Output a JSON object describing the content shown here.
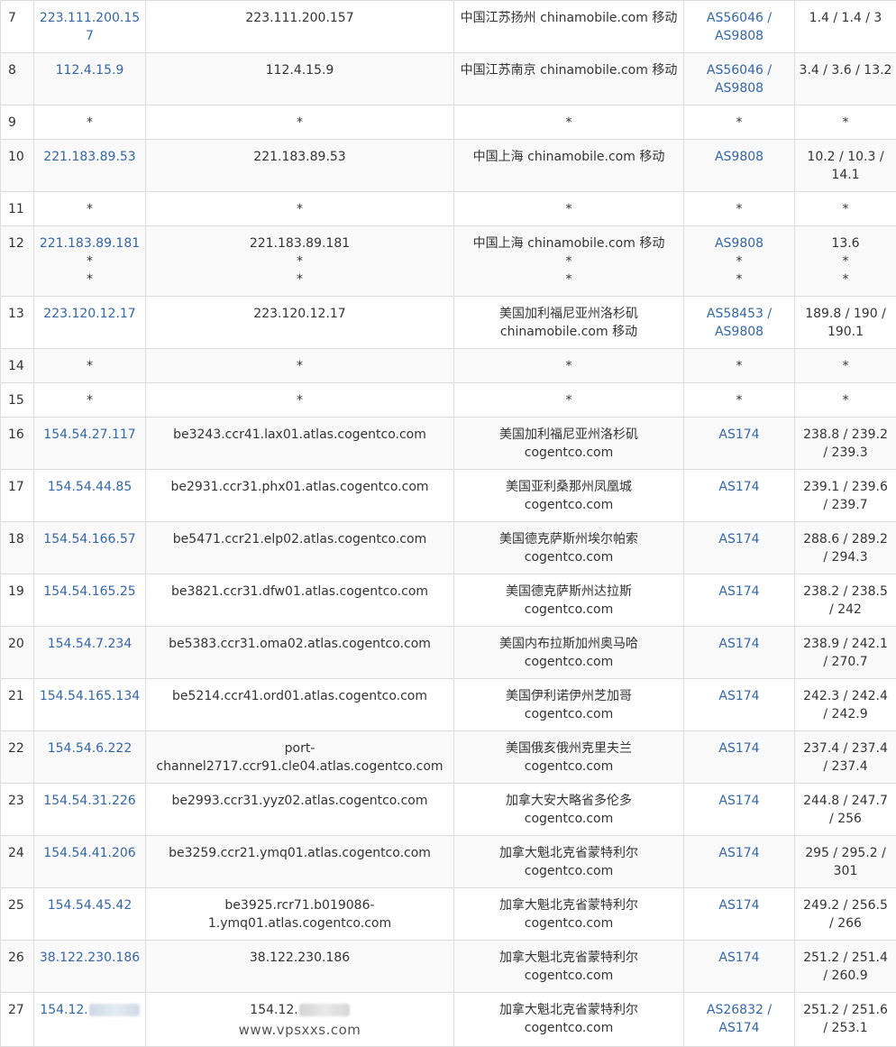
{
  "watermark": "www.vpsxxs.com",
  "rows": [
    {
      "hop": "7",
      "ip": [
        "223.111.200.157"
      ],
      "host": [
        "223.111.200.157"
      ],
      "loc": [
        "中国江苏扬州 chinamobile.com 移动"
      ],
      "asn": [
        "AS56046 /",
        "AS9808"
      ],
      "asn_link": [
        true,
        true
      ],
      "rtt": [
        "1.4 / 1.4 / 3"
      ]
    },
    {
      "hop": "8",
      "ip": [
        "112.4.15.9"
      ],
      "host": [
        "112.4.15.9"
      ],
      "loc": [
        "中国江苏南京 chinamobile.com 移动"
      ],
      "asn": [
        "AS56046 /",
        "AS9808"
      ],
      "asn_link": [
        true,
        true
      ],
      "rtt": [
        "3.4 / 3.6 / 13.2"
      ]
    },
    {
      "hop": "9",
      "ip": [
        "*"
      ],
      "host": [
        "*"
      ],
      "loc": [
        "*"
      ],
      "asn": [
        "*"
      ],
      "asn_link": [
        false
      ],
      "rtt": [
        "*"
      ]
    },
    {
      "hop": "10",
      "ip": [
        "221.183.89.53"
      ],
      "host": [
        "221.183.89.53"
      ],
      "loc": [
        "中国上海 chinamobile.com 移动"
      ],
      "asn": [
        "AS9808"
      ],
      "asn_link": [
        true
      ],
      "rtt": [
        "10.2 / 10.3 /",
        "14.1"
      ]
    },
    {
      "hop": "11",
      "ip": [
        "*"
      ],
      "host": [
        "*"
      ],
      "loc": [
        "*"
      ],
      "asn": [
        "*"
      ],
      "asn_link": [
        false
      ],
      "rtt": [
        "*"
      ]
    },
    {
      "hop": "12",
      "ip": [
        "221.183.89.181",
        "*",
        "*"
      ],
      "host": [
        "221.183.89.181",
        "*",
        "*"
      ],
      "loc": [
        "中国上海 chinamobile.com 移动",
        "*",
        "*"
      ],
      "asn": [
        "AS9808",
        "*",
        "*"
      ],
      "asn_link": [
        true,
        false,
        false
      ],
      "rtt": [
        "13.6",
        "*",
        "*"
      ]
    },
    {
      "hop": "13",
      "ip": [
        "223.120.12.17"
      ],
      "host": [
        "223.120.12.17"
      ],
      "loc": [
        "美国加利福尼亚州洛杉矶",
        "chinamobile.com 移动"
      ],
      "asn": [
        "AS58453 /",
        "AS9808"
      ],
      "asn_link": [
        true,
        true
      ],
      "rtt": [
        "189.8 / 190 /",
        "190.1"
      ]
    },
    {
      "hop": "14",
      "ip": [
        "*"
      ],
      "host": [
        "*"
      ],
      "loc": [
        "*"
      ],
      "asn": [
        "*"
      ],
      "asn_link": [
        false
      ],
      "rtt": [
        "*"
      ]
    },
    {
      "hop": "15",
      "ip": [
        "*"
      ],
      "host": [
        "*"
      ],
      "loc": [
        "*"
      ],
      "asn": [
        "*"
      ],
      "asn_link": [
        false
      ],
      "rtt": [
        "*"
      ]
    },
    {
      "hop": "16",
      "ip": [
        "154.54.27.117"
      ],
      "host": [
        "be3243.ccr41.lax01.atlas.cogentco.com"
      ],
      "loc": [
        "美国加利福尼亚州洛杉矶",
        "cogentco.com"
      ],
      "asn": [
        "AS174"
      ],
      "asn_link": [
        true
      ],
      "rtt": [
        "238.8 / 239.2",
        "/ 239.3"
      ]
    },
    {
      "hop": "17",
      "ip": [
        "154.54.44.85"
      ],
      "host": [
        "be2931.ccr31.phx01.atlas.cogentco.com"
      ],
      "loc": [
        "美国亚利桑那州凤凰城",
        "cogentco.com"
      ],
      "asn": [
        "AS174"
      ],
      "asn_link": [
        true
      ],
      "rtt": [
        "239.1 / 239.6",
        "/ 239.7"
      ]
    },
    {
      "hop": "18",
      "ip": [
        "154.54.166.57"
      ],
      "host": [
        "be5471.ccr21.elp02.atlas.cogentco.com"
      ],
      "loc": [
        "美国德克萨斯州埃尔帕索",
        "cogentco.com"
      ],
      "asn": [
        "AS174"
      ],
      "asn_link": [
        true
      ],
      "rtt": [
        "288.6 / 289.2",
        "/ 294.3"
      ]
    },
    {
      "hop": "19",
      "ip": [
        "154.54.165.25"
      ],
      "host": [
        "be3821.ccr31.dfw01.atlas.cogentco.com"
      ],
      "loc": [
        "美国德克萨斯州达拉斯",
        "cogentco.com"
      ],
      "asn": [
        "AS174"
      ],
      "asn_link": [
        true
      ],
      "rtt": [
        "238.2 / 238.5",
        "/ 242"
      ]
    },
    {
      "hop": "20",
      "ip": [
        "154.54.7.234"
      ],
      "host": [
        "be5383.ccr31.oma02.atlas.cogentco.com"
      ],
      "loc": [
        "美国内布拉斯加州奥马哈",
        "cogentco.com"
      ],
      "asn": [
        "AS174"
      ],
      "asn_link": [
        true
      ],
      "rtt": [
        "238.9 / 242.1",
        "/ 270.7"
      ]
    },
    {
      "hop": "21",
      "ip": [
        "154.54.165.134"
      ],
      "host": [
        "be5214.ccr41.ord01.atlas.cogentco.com"
      ],
      "loc": [
        "美国伊利诺伊州芝加哥",
        "cogentco.com"
      ],
      "asn": [
        "AS174"
      ],
      "asn_link": [
        true
      ],
      "rtt": [
        "242.3 / 242.4",
        "/ 242.9"
      ]
    },
    {
      "hop": "22",
      "ip": [
        "154.54.6.222"
      ],
      "host": [
        "port-",
        "channel2717.ccr91.cle04.atlas.cogentco.com"
      ],
      "loc": [
        "美国俄亥俄州克里夫兰",
        "cogentco.com"
      ],
      "asn": [
        "AS174"
      ],
      "asn_link": [
        true
      ],
      "rtt": [
        "237.4 / 237.4",
        "/ 237.4"
      ]
    },
    {
      "hop": "23",
      "ip": [
        "154.54.31.226"
      ],
      "host": [
        "be2993.ccr31.yyz02.atlas.cogentco.com"
      ],
      "loc": [
        "加拿大安大略省多伦多",
        "cogentco.com"
      ],
      "asn": [
        "AS174"
      ],
      "asn_link": [
        true
      ],
      "rtt": [
        "244.8 / 247.7",
        "/ 256"
      ]
    },
    {
      "hop": "24",
      "ip": [
        "154.54.41.206"
      ],
      "host": [
        "be3259.ccr21.ymq01.atlas.cogentco.com"
      ],
      "loc": [
        "加拿大魁北克省蒙特利尔",
        "cogentco.com"
      ],
      "asn": [
        "AS174"
      ],
      "asn_link": [
        true
      ],
      "rtt": [
        "295 / 295.2 /",
        "301"
      ]
    },
    {
      "hop": "25",
      "ip": [
        "154.54.45.42"
      ],
      "host": [
        "be3925.rcr71.b019086-",
        "1.ymq01.atlas.cogentco.com"
      ],
      "loc": [
        "加拿大魁北克省蒙特利尔",
        "cogentco.com"
      ],
      "asn": [
        "AS174"
      ],
      "asn_link": [
        true
      ],
      "rtt": [
        "249.2 / 256.5",
        "/ 266"
      ]
    },
    {
      "hop": "26",
      "ip": [
        "38.122.230.186"
      ],
      "host": [
        "38.122.230.186"
      ],
      "loc": [
        "加拿大魁北克省蒙特利尔",
        "cogentco.com"
      ],
      "asn": [
        "AS174"
      ],
      "asn_link": [
        true
      ],
      "rtt": [
        "251.2 / 251.4",
        "/ 260.9"
      ]
    },
    {
      "hop": "27",
      "ip": [
        "154.12."
      ],
      "host": [
        "154.12."
      ],
      "loc": [
        "加拿大魁北克省蒙特利尔",
        "cogentco.com"
      ],
      "asn": [
        "AS26832 /",
        "AS174"
      ],
      "asn_link": [
        true,
        true
      ],
      "rtt": [
        "251.2 / 251.6",
        "/ 253.1"
      ],
      "masked": true
    }
  ]
}
